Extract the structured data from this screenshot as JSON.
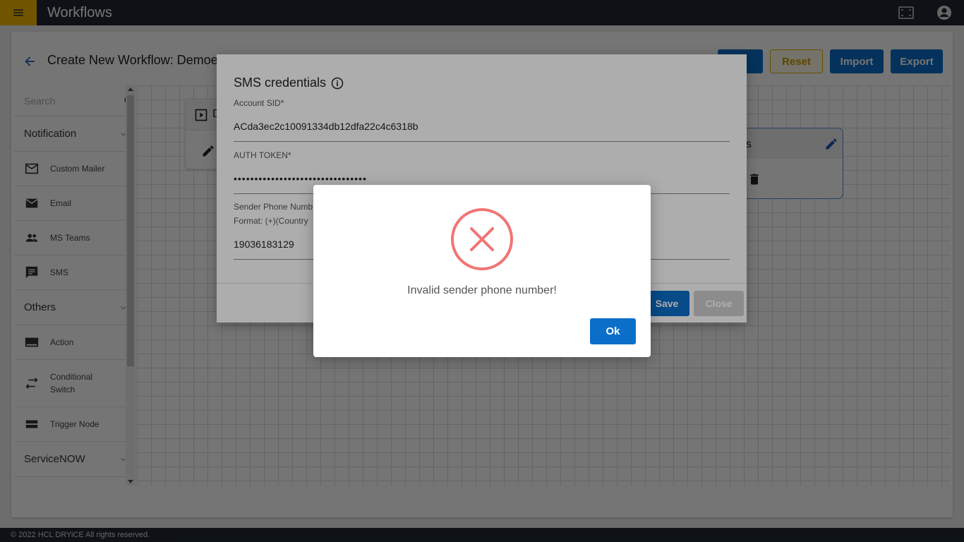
{
  "app": {
    "title": "Workflows",
    "footer": "© 2022 HCL DRYiCE All rights reserved."
  },
  "header": {
    "page_title": "Create New Workflow: Demoe:",
    "save_label": "e",
    "reset_label": "Reset",
    "import_label": "Import",
    "export_label": "Export"
  },
  "sidebar": {
    "search_placeholder": "Search",
    "sections": [
      {
        "label": "Notification"
      },
      {
        "label": "Others"
      },
      {
        "label": "ServiceNOW"
      }
    ],
    "items": [
      {
        "label": "Custom Mailer",
        "icon": "mail-outline-icon"
      },
      {
        "label": "Email",
        "icon": "mail-icon"
      },
      {
        "label": "MS Teams",
        "icon": "people-icon"
      },
      {
        "label": "SMS",
        "icon": "sms-icon"
      },
      {
        "label": "Action",
        "icon": "action-icon"
      },
      {
        "label": "Conditional Switch",
        "icon": "swap-icon"
      },
      {
        "label": "Trigger Node",
        "icon": "trigger-icon"
      }
    ]
  },
  "canvas": {
    "node1_label": "D",
    "node2_label": "s"
  },
  "sms_dialog": {
    "title": "SMS credentials",
    "account_sid_label": "Account SID*",
    "account_sid_value": "ACda3ec2c10091334db12dfa22c4c6318b",
    "auth_token_label": "AUTH TOKEN*",
    "auth_token_value": "••••••••••••••••••••••••••••••••",
    "sender_label": "Sender Phone Numb",
    "sender_format": "Format: (+)(Country",
    "sender_value": "19036183129",
    "save_label": "Save",
    "close_label": "Close"
  },
  "alert": {
    "message": "Invalid sender phone number!",
    "ok_label": "Ok"
  },
  "colors": {
    "accent": "#0b6fc9",
    "topbar": "#1f2933",
    "menu": "#f5b800",
    "error": "#f27474"
  }
}
